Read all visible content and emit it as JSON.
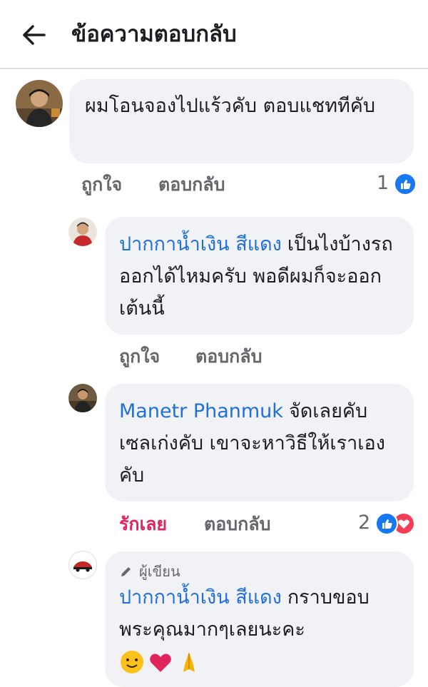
{
  "header": {
    "title": "ข้อความตอบกลับ"
  },
  "comments": [
    {
      "text": "ผมโอนจองไปแร้วคับ ตอบแชททีคับ",
      "like_label": "ถูกใจ",
      "reply_label": "ตอบกลับ",
      "reaction_count": "1",
      "reactions": [
        "like-icon"
      ]
    },
    {
      "author": "ปากกาน้ำเงิน สีแดง",
      "text": "เป็นไงบ้างรถออกได้ไหมครับ พอดีผมก็จะออกเต้นนี้",
      "like_label": "ถูกใจ",
      "reply_label": "ตอบกลับ"
    },
    {
      "author": "Manetr Phanmuk",
      "text": "จัดเลยคับ เซลเก่งคับ เขาจะหาวิธีให้เราเองคับ",
      "like_label": "รักเลย",
      "reply_label": "ตอบกลับ",
      "reaction_count": "2",
      "reactions": [
        "like-icon",
        "love-icon"
      ]
    },
    {
      "badge": "ผู้เขียน",
      "author": "ปากกาน้ำเงิน สีแดง",
      "text": "กราบขอบพระคุณมากๆเลยนะคะ",
      "emojis": [
        "smile-emoji",
        "heart-emoji",
        "pray-emoji"
      ]
    }
  ],
  "colors": {
    "link": "#216fdb",
    "like": "#1877f2",
    "love": "#f33e58",
    "loved_label": "#e0245e"
  }
}
